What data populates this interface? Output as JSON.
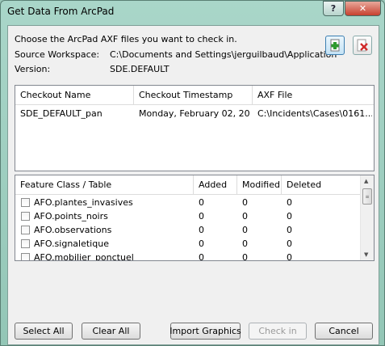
{
  "window": {
    "title": "Get Data From ArcPad",
    "help_label": "?",
    "close_label": "✕"
  },
  "info": {
    "instruction": "Choose the ArcPad AXF files you want to check in.",
    "source_label": "Source Workspace:",
    "source_value": "C:\\Documents and Settings\\jerguilbaud\\Application",
    "version_label": "Version:",
    "version_value": "SDE.DEFAULT"
  },
  "icons": {
    "add": "add-file-icon",
    "remove": "remove-file-icon"
  },
  "checkout_table": {
    "headers": [
      "Checkout Name",
      "Checkout Timestamp",
      "AXF File"
    ],
    "rows": [
      [
        "SDE_DEFAULT_pan",
        "Monday, February 02, 20...",
        "C:\\Incidents\\Cases\\0161..."
      ]
    ]
  },
  "feature_table": {
    "headers": [
      "Feature Class / Table",
      "Added",
      "Modified",
      "Deleted"
    ],
    "rows": [
      [
        "AFO.plantes_invasives",
        "0",
        "0",
        "0"
      ],
      [
        "AFO.points_noirs",
        "0",
        "0",
        "0"
      ],
      [
        "AFO.observations",
        "0",
        "0",
        "0"
      ],
      [
        "AFO.signaletique",
        "0",
        "0",
        "0"
      ],
      [
        "AFO.mobilier_ponctuel",
        "0",
        "0",
        "0"
      ]
    ]
  },
  "buttons": {
    "select_all": "Select All",
    "clear_all": "Clear All",
    "import_graphics": "Import Graphics",
    "check_in": "Check in",
    "cancel": "Cancel"
  }
}
